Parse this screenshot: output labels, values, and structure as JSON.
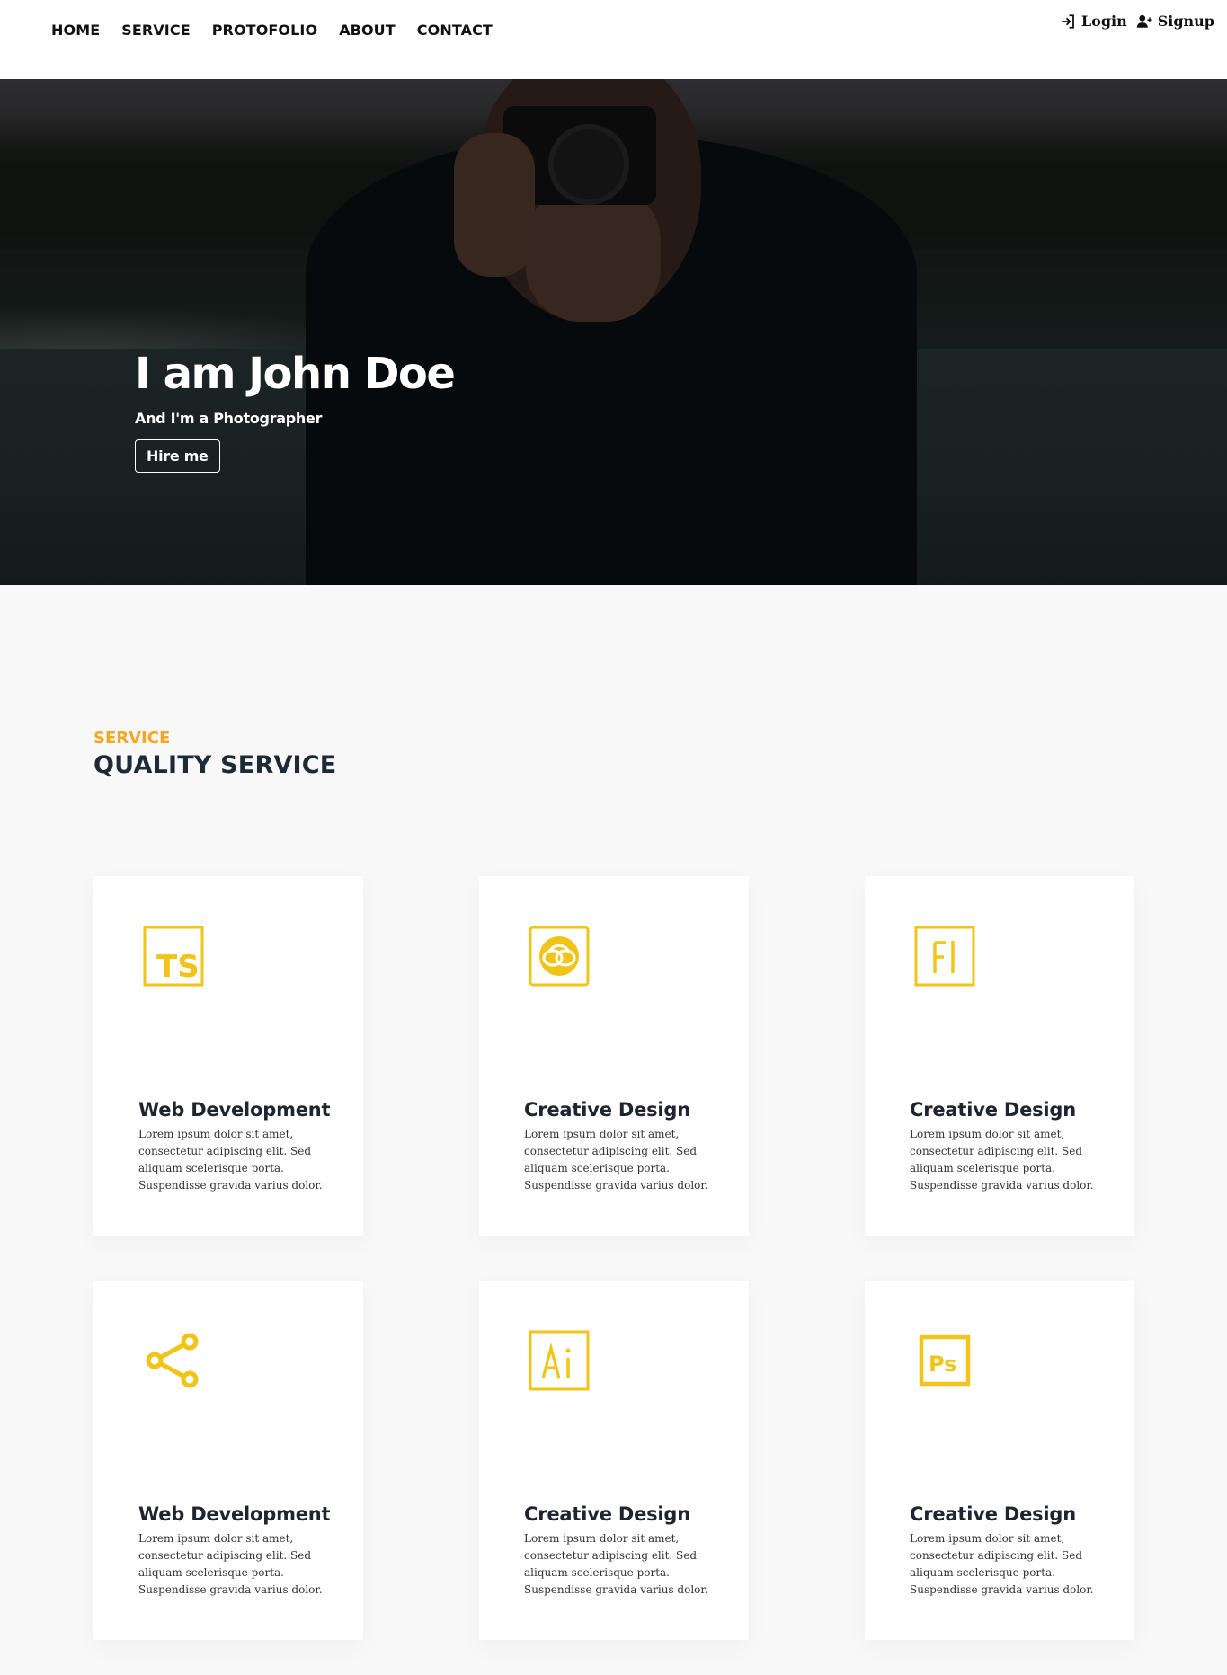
{
  "nav": {
    "links": [
      "HOME",
      "SERVICE",
      "PROTOFOLIO",
      "ABOUT",
      "CONTACT"
    ],
    "login": "Login",
    "signup": "Signup"
  },
  "hero": {
    "title": "I am John Doe",
    "subtitle": "And I'm a Photographer",
    "cta": "Hire me"
  },
  "services": {
    "kicker": "SERVICE",
    "title": "QUALITY SERVICE",
    "accent_color": "#f0c419",
    "kicker_color": "#f5a623",
    "cards": [
      {
        "icon": "typescript-icon",
        "title": "Web Development",
        "text": "Lorem ipsum dolor sit amet, consectetur adipiscing elit. Sed aliquam scelerisque porta. Suspendisse gravida varius dolor."
      },
      {
        "icon": "creative-cloud-icon",
        "title": "Creative Design",
        "text": "Lorem ipsum dolor sit amet, consectetur adipiscing elit. Sed aliquam scelerisque porta. Suspendisse gravida varius dolor."
      },
      {
        "icon": "flash-icon",
        "title": "Creative Design",
        "text": "Lorem ipsum dolor sit amet, consectetur adipiscing elit. Sed aliquam scelerisque porta. Suspendisse gravida varius dolor."
      },
      {
        "icon": "share-icon",
        "title": "Web Development",
        "text": "Lorem ipsum dolor sit amet, consectetur adipiscing elit. Sed aliquam scelerisque porta. Suspendisse gravida varius dolor."
      },
      {
        "icon": "illustrator-icon",
        "title": "Creative Design",
        "text": "Lorem ipsum dolor sit amet, consectetur adipiscing elit. Sed aliquam scelerisque porta. Suspendisse gravida varius dolor."
      },
      {
        "icon": "photoshop-icon",
        "title": "Creative Design",
        "text": "Lorem ipsum dolor sit amet, consectetur adipiscing elit. Sed aliquam scelerisque porta. Suspendisse gravida varius dolor."
      }
    ]
  }
}
